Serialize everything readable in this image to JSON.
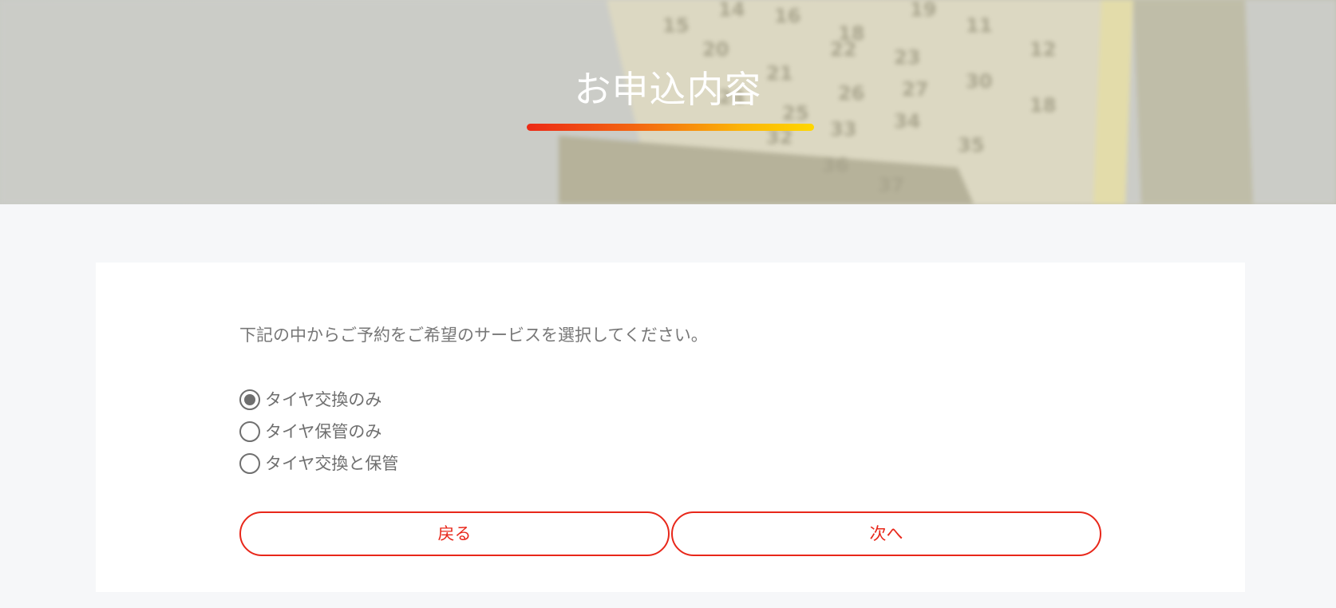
{
  "header": {
    "title": "お申込内容",
    "underline_gradient": [
      "#ec2a16",
      "#ffd700"
    ]
  },
  "form": {
    "instruction": "下記の中からご予約をご希望のサービスを選択してください。",
    "options": [
      {
        "label": "タイヤ交換のみ",
        "checked": true
      },
      {
        "label": "タイヤ保管のみ",
        "checked": false
      },
      {
        "label": "タイヤ交換と保管",
        "checked": false
      }
    ]
  },
  "buttons": {
    "back_label": "戻る",
    "next_label": "次へ"
  },
  "colors": {
    "accent": "#e8271a",
    "text_gray": "#777777",
    "page_bg": "#f6f7f9"
  }
}
